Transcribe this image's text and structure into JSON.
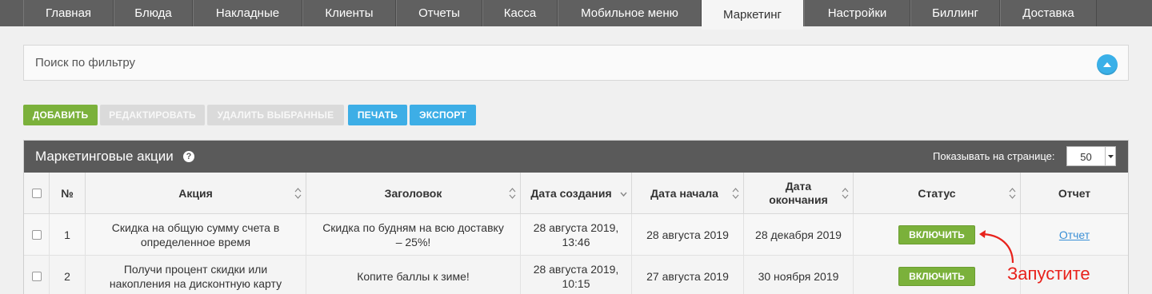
{
  "nav": {
    "tabs": [
      "Главная",
      "Блюда",
      "Накладные",
      "Клиенты",
      "Отчеты",
      "Касса",
      "Мобильное меню",
      "Маркетинг",
      "Настройки",
      "Биллинг",
      "Доставка"
    ],
    "active": "Маркетинг"
  },
  "filter": {
    "label": "Поиск по фильтру"
  },
  "toolbar": {
    "add": "ДОБАВИТЬ",
    "edit": "РЕДАКТИРОВАТЬ",
    "delete": "УДАЛИТЬ ВЫБРАННЫЕ",
    "print": "ПЕЧАТЬ",
    "export": "ЭКСПОРТ"
  },
  "panel": {
    "title": "Маркетинговые акции",
    "help": "?",
    "per_page_label": "Показывать на странице:",
    "per_page_value": "50"
  },
  "table": {
    "headers": {
      "num": "№",
      "action": "Акция",
      "title": "Заголовок",
      "created_date": "Дата создания",
      "start_date": "Дата начала",
      "end_date_line1": "Дата",
      "end_date_line2": "окончания",
      "status": "Статус",
      "report": "Отчет"
    },
    "rows": [
      {
        "num": "1",
        "action_line1": "Скидка на общую сумму счета в",
        "action_line2": "определенное время",
        "title_line1": "Скидка по будням на всю доставку",
        "title_line2": "– 25%!",
        "created_line1": "28 августа 2019,",
        "created_line2": "13:46",
        "start": "28 августа 2019",
        "end": "28 декабря 2019",
        "status": "ВКЛЮЧИТЬ",
        "report": "Отчет"
      },
      {
        "num": "2",
        "action_line1": "Получи процент скидки или",
        "action_line2": "накопления на дисконтную карту",
        "title_line1": "Копите баллы к зиме!",
        "title_line2": "",
        "created_line1": "28 августа 2019,",
        "created_line2": "10:15",
        "start": "27 августа 2019",
        "end": "30 ноября 2019",
        "status": "ВКЛЮЧИТЬ",
        "report": ""
      }
    ]
  },
  "annotation": {
    "text": "Запустите",
    "color": "#e8221c"
  },
  "colors": {
    "green": "#7bb13b",
    "blue": "#3daee6",
    "header_dark": "#5a5a5a"
  }
}
